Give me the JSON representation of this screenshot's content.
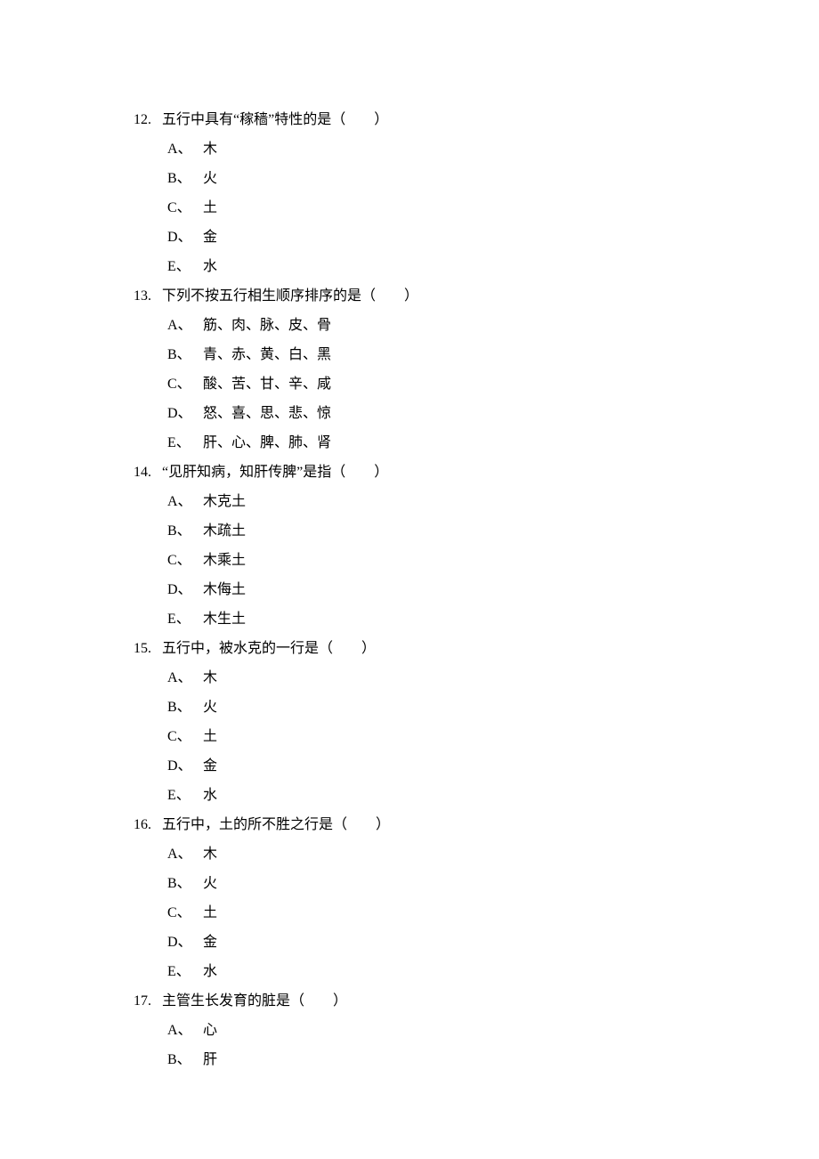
{
  "questions": [
    {
      "num": "12.",
      "stem": "五行中具有“稼穑”特性的是（　　）",
      "options": [
        {
          "label": "A、",
          "text": "木"
        },
        {
          "label": "B、",
          "text": "火"
        },
        {
          "label": "C、",
          "text": "土"
        },
        {
          "label": "D、",
          "text": "金"
        },
        {
          "label": "E、",
          "text": "水"
        }
      ]
    },
    {
      "num": "13.",
      "stem": "下列不按五行相生顺序排序的是（　　）",
      "options": [
        {
          "label": "A、",
          "text": "筋、肉、脉、皮、骨"
        },
        {
          "label": "B、",
          "text": "青、赤、黄、白、黑"
        },
        {
          "label": "C、",
          "text": "酸、苦、甘、辛、咸"
        },
        {
          "label": "D、",
          "text": "怒、喜、思、悲、惊"
        },
        {
          "label": "E、",
          "text": "肝、心、脾、肺、肾"
        }
      ]
    },
    {
      "num": "14.",
      "stem": "“见肝知病，知肝传脾”是指（　　）",
      "options": [
        {
          "label": "A、",
          "text": "木克土"
        },
        {
          "label": "B、",
          "text": "木疏土"
        },
        {
          "label": "C、",
          "text": "木乘土"
        },
        {
          "label": "D、",
          "text": "木侮土"
        },
        {
          "label": "E、",
          "text": "木生土"
        }
      ]
    },
    {
      "num": "15.",
      "stem": "五行中，被水克的一行是（　　）",
      "options": [
        {
          "label": "A、",
          "text": "木"
        },
        {
          "label": "B、",
          "text": "火"
        },
        {
          "label": "C、",
          "text": "土"
        },
        {
          "label": "D、",
          "text": "金"
        },
        {
          "label": "E、",
          "text": "水"
        }
      ]
    },
    {
      "num": "16.",
      "stem": "五行中，土的所不胜之行是（　　）",
      "options": [
        {
          "label": "A、",
          "text": "木"
        },
        {
          "label": "B、",
          "text": "火"
        },
        {
          "label": "C、",
          "text": "土"
        },
        {
          "label": "D、",
          "text": "金"
        },
        {
          "label": "E、",
          "text": "水"
        }
      ]
    },
    {
      "num": "17.",
      "stem": "主管生长发育的脏是（　　）",
      "options": [
        {
          "label": "A、",
          "text": "心"
        },
        {
          "label": "B、",
          "text": "肝"
        }
      ]
    }
  ]
}
